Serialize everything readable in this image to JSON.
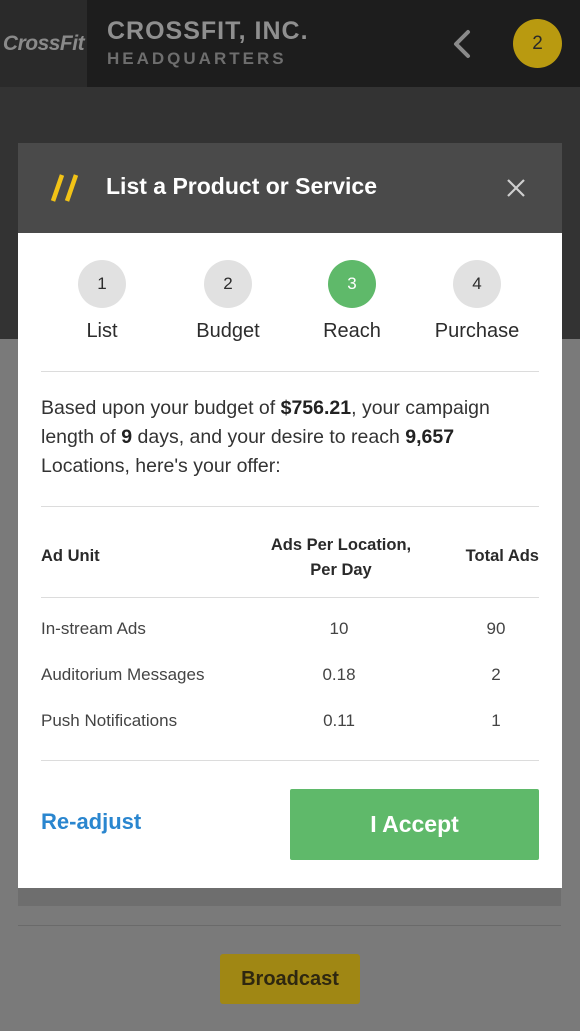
{
  "app": {
    "logo_text": "CrossFit",
    "title": "CROSSFIT, INC.",
    "subtitle": "HEADQUARTERS",
    "badge_count": "2",
    "back_icon": "chevron-left-icon",
    "accent_color": "#c9a512"
  },
  "modal": {
    "title": "List a Product or Service",
    "title_icon": "double-slash-icon",
    "close_icon": "close-icon",
    "steps": [
      {
        "number": "1",
        "label": "List",
        "active": false
      },
      {
        "number": "2",
        "label": "Budget",
        "active": false
      },
      {
        "number": "3",
        "label": "Reach",
        "active": true
      },
      {
        "number": "4",
        "label": "Purchase",
        "active": false
      }
    ],
    "offer": {
      "t1": "Based upon your budget of ",
      "budget": "$756.21",
      "t2": ", your campaign length of ",
      "days": "9",
      "t3": " days, and your desire to reach ",
      "locations": "9,657",
      "t4": " Locations, here's your offer:"
    },
    "table": {
      "headers": [
        "Ad Unit",
        "Ads Per Location,\nPer Day",
        "Total Ads"
      ],
      "rows": [
        {
          "unit": "In-stream Ads",
          "per_day": "10",
          "total": "90"
        },
        {
          "unit": "Auditorium Messages",
          "per_day": "0.18",
          "total": "2"
        },
        {
          "unit": "Push Notifications",
          "per_day": "0.11",
          "total": "1"
        }
      ]
    },
    "readjust_label": "Re-adjust",
    "accept_label": "I Accept",
    "accept_color": "#5fb96a",
    "link_color": "#2a86cf"
  },
  "background": {
    "broadcast_label": "Broadcast"
  }
}
